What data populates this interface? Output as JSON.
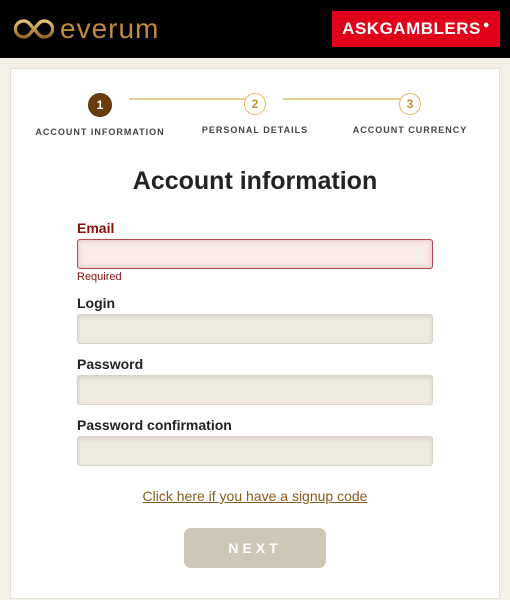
{
  "header": {
    "brand_name": "everum",
    "partner_badge": "ASKGAMBLERS"
  },
  "steps": {
    "items": [
      {
        "num": "1",
        "label": "ACCOUNT INFORMATION",
        "active": true
      },
      {
        "num": "2",
        "label": "PERSONAL DETAILS",
        "active": false
      },
      {
        "num": "3",
        "label": "ACCOUNT CURRENCY",
        "active": false
      }
    ]
  },
  "title": "Account information",
  "form": {
    "email": {
      "label": "Email",
      "value": "",
      "error": "Required"
    },
    "login": {
      "label": "Login",
      "value": ""
    },
    "password": {
      "label": "Password",
      "value": ""
    },
    "password_confirm": {
      "label": "Password confirmation",
      "value": ""
    }
  },
  "signup_code_link": "Click here if you have a signup code",
  "next_button": "NEXT"
}
